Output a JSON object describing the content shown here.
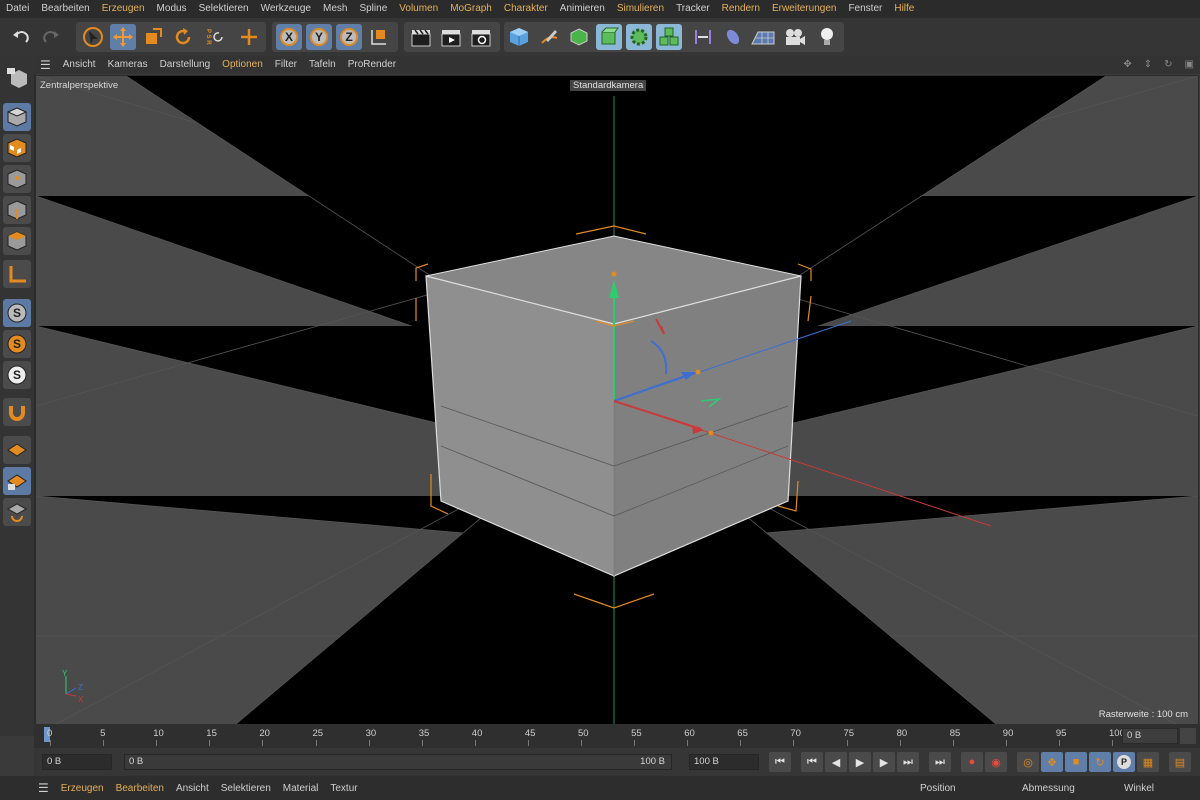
{
  "menu": [
    "Datei",
    "Bearbeiten",
    "Erzeugen",
    "Modus",
    "Selektieren",
    "Werkzeuge",
    "Mesh",
    "Spline",
    "Volumen",
    "MoGraph",
    "Charakter",
    "Animieren",
    "Simulieren",
    "Tracker",
    "Rendern",
    "Erweiterungen",
    "Fenster",
    "Hilfe"
  ],
  "viewport_menu": [
    "Ansicht",
    "Kameras",
    "Darstellung",
    "Optionen",
    "Filter",
    "Tafeln",
    "ProRender"
  ],
  "viewport": {
    "projection": "Zentralperspektive",
    "camera": "Standardkamera",
    "grid_size": "Rasterweite : 100 cm",
    "axis_y": "Y",
    "axis_z": "Z",
    "axis_x": "X"
  },
  "toolbar": {
    "axis_x": "X",
    "axis_y": "Y",
    "axis_z": "Z",
    "psr": "P S R"
  },
  "left_palette": {
    "s1": "S",
    "s2": "S",
    "s3": "S"
  },
  "timeline": {
    "ticks": [
      "0",
      "5",
      "10",
      "15",
      "20",
      "25",
      "30",
      "35",
      "40",
      "45",
      "50",
      "55",
      "60",
      "65",
      "70",
      "75",
      "80",
      "85",
      "90",
      "95",
      "100"
    ],
    "right_field": "0 B"
  },
  "transport": {
    "field_start": "0 B",
    "field_range_start": "0 B",
    "field_range_end": "100 B",
    "field_end": "100 B",
    "record_p": "P"
  },
  "bottom_menu": [
    "Erzeugen",
    "Bearbeiten",
    "Ansicht",
    "Selektieren",
    "Material",
    "Textur"
  ],
  "bottom_right": [
    "Position",
    "Abmessung",
    "Winkel"
  ],
  "colors": {
    "accent_orange": "#e38b1e",
    "selection_blue": "#5f7ea8",
    "axis_x": "#c93a3a",
    "axis_y": "#2ecc71",
    "axis_z": "#3c6fd1"
  }
}
